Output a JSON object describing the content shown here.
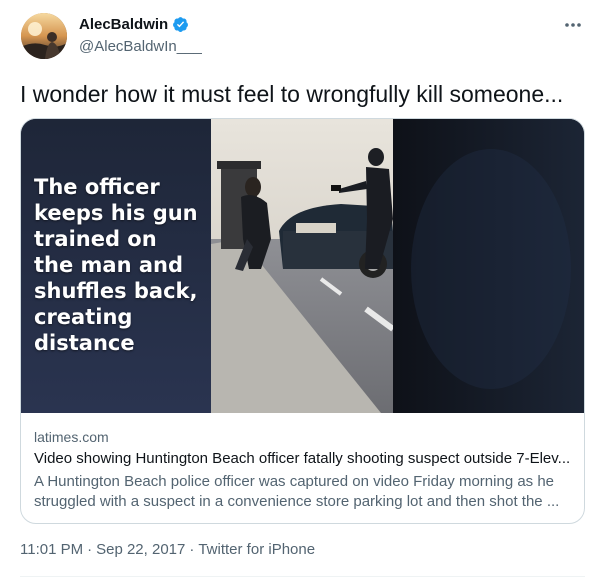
{
  "author": {
    "display_name": "AlecBaldwin",
    "handle": "@AlecBaldwIn___"
  },
  "tweet": {
    "text": "I wonder how it must feel to wrongfully kill someone..."
  },
  "card": {
    "media_caption": "The officer\nkeeps his gun\ntrained on\nthe man and\nshuffles back,\ncreating\ndistance",
    "domain": "latimes.com",
    "title": "Video showing Huntington Beach officer fatally shooting suspect outside 7-Elev...",
    "description": "A Huntington Beach police officer was captured on video Friday morning as he struggled with a suspect in a convenience store parking lot and then shot the ..."
  },
  "meta": {
    "time": "11:01 PM",
    "separator1": "·",
    "date": "Sep 22, 2017",
    "separator2": "·",
    "source": "Twitter for iPhone"
  },
  "colors": {
    "verified": "#1d9bf0",
    "secondary_text": "#536471",
    "border": "#cfd9de"
  },
  "icons": {
    "verified": "verified-badge-icon",
    "more": "more-dots-icon"
  }
}
